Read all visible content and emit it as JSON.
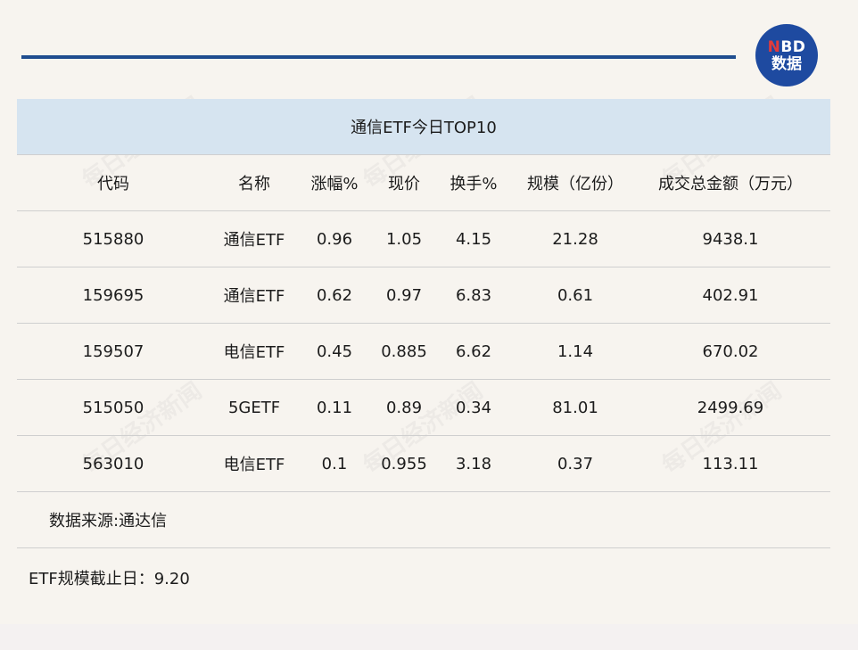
{
  "logo": {
    "brand": "NBD",
    "sub": "数据"
  },
  "table": {
    "title": "通信ETF今日TOP10",
    "headers": {
      "code": "代码",
      "name": "名称",
      "change": "涨幅%",
      "price": "现价",
      "turnover": "换手%",
      "scale": "规模（亿份）",
      "amount": "成交总金额（万元）"
    },
    "rows": [
      {
        "code": "515880",
        "name": "通信ETF",
        "change": "0.96",
        "price": "1.05",
        "turnover": "4.15",
        "scale": "21.28",
        "amount": "9438.1"
      },
      {
        "code": "159695",
        "name": "通信ETF",
        "change": "0.62",
        "price": "0.97",
        "turnover": "6.83",
        "scale": "0.61",
        "amount": "402.91"
      },
      {
        "code": "159507",
        "name": "电信ETF",
        "change": "0.45",
        "price": "0.885",
        "turnover": "6.62",
        "scale": "1.14",
        "amount": "670.02"
      },
      {
        "code": "515050",
        "name": "5GETF",
        "change": "0.11",
        "price": "0.89",
        "turnover": "0.34",
        "scale": "81.01",
        "amount": "2499.69"
      },
      {
        "code": "563010",
        "name": "电信ETF",
        "change": "0.1",
        "price": "0.955",
        "turnover": "3.18",
        "scale": "0.37",
        "amount": "113.11"
      }
    ]
  },
  "notes": {
    "source": "数据来源:通达信",
    "scale_date": "ETF规模截止日：9.20"
  },
  "watermark": {
    "text": "每日经济新闻"
  },
  "colors": {
    "accent": "#1f4d8f",
    "logo_bg": "#1e4aa0",
    "title_bg": "#d6e4f0",
    "page_bg": "#f7f4ef"
  }
}
